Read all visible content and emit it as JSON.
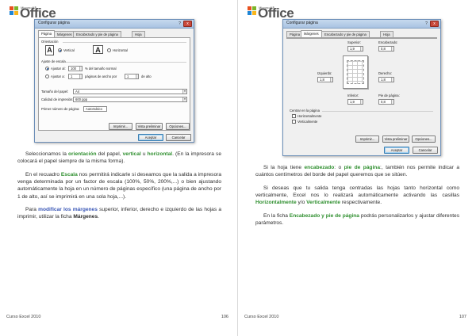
{
  "logo": {
    "microsoft": "Microsoft®",
    "office": "Office"
  },
  "left_dialog": {
    "title": "Configurar página",
    "help": "?",
    "close": "x",
    "tabs": [
      "Página",
      "Márgenes",
      "Encabezado y pie de página",
      "Hoja"
    ],
    "orientation_label": "Orientación",
    "icon_vertical": "A",
    "icon_horizontal": "A",
    "vertical_label": "Vertical",
    "horizontal_label": "Horizontal",
    "scale_label": "Ajuste de escala",
    "adjust_label": "Ajustar al:",
    "adjust_value": "100",
    "adjust_suffix": "% del tamaño normal",
    "fit_label": "Ajustar a:",
    "fit_wide": "1",
    "fit_mid": "páginas de ancho por",
    "fit_tall": "1",
    "fit_suffix": "de alto",
    "paper_label": "Tamaño del papel:",
    "paper_value": "A4",
    "quality_label": "Calidad de impresión:",
    "quality_value": "600 ppp",
    "first_page_label": "Primer número de página:",
    "first_page_value": "Automático",
    "btn_print": "Imprimir...",
    "btn_preview": "Vista preliminar",
    "btn_options": "Opciones...",
    "btn_accept": "Aceptar",
    "btn_cancel": "Cancelar"
  },
  "right_dialog": {
    "title": "Configurar página",
    "help": "?",
    "close": "x",
    "tabs": [
      "Página",
      "Márgenes",
      "Encabezado y pie de página",
      "Hoja"
    ],
    "top_label": "Superior:",
    "top_value": "1,9",
    "header_label": "Encabezado:",
    "header_value": "0,8",
    "left_label": "Izquierdo:",
    "left_value": "1,8",
    "right_label": "Derecho:",
    "right_value": "1,8",
    "bottom_label": "Inferior:",
    "bottom_value": "1,9",
    "footer_label": "Pie de página:",
    "footer_value": "0,8",
    "center_label": "Centrar en la página",
    "horiz_label": "Horizontalmente",
    "vert_label": "Verticalmente",
    "btn_print": "Imprimir...",
    "btn_preview": "Vista preliminar",
    "btn_options": "Opciones...",
    "btn_accept": "Aceptar",
    "btn_cancel": "Cancelar"
  },
  "left_text": {
    "p1": [
      "Seleccionamos la ",
      "orientación",
      " del papel, ",
      "vertical",
      " u ",
      "horizontal",
      ". (En la impresora se colocará el papel siempre de la misma forma)."
    ],
    "p2": [
      "En el recuadro ",
      "Escala",
      " nos permitirá indicarle si deseamos que la salida a impresora venga determinada por un factor de escala (100%, 50%, 200%,...) o bien ajustando automáticamente la hoja en un número de páginas específico (una página de ancho por 1 de alto, así se imprimirá en una sola hoja,...)."
    ],
    "p3": [
      "Para ",
      "modificar los márgenes",
      " superior, inferior, derecho e izquierdo de las hojas a imprimir, utilizar la ficha ",
      "Márgenes",
      "."
    ]
  },
  "right_text": {
    "p1": [
      "Si la hoja tiene ",
      "encabezado",
      ": o ",
      "pie de página",
      ":, también nos permite indicar a cuántos centímetros del borde del papel queremos que se sitúen."
    ],
    "p2": [
      "Si deseas que tu salida tenga centradas las hojas tanto horizontal como verticalmente, Excel nos lo realizará automáticamente activando las casillas ",
      "Horizontalmente",
      " y/o ",
      "Verticalmente",
      " respectivamente."
    ],
    "p3": [
      "En la ficha ",
      "Encabezado y pie de página",
      " podrás personalizarlos y ajustar diferentes parámetros."
    ]
  },
  "footer": {
    "left_label": "Curso Excel 2010",
    "left_page": "106",
    "right_label": "Curso Excel 2010",
    "right_page": "107"
  }
}
